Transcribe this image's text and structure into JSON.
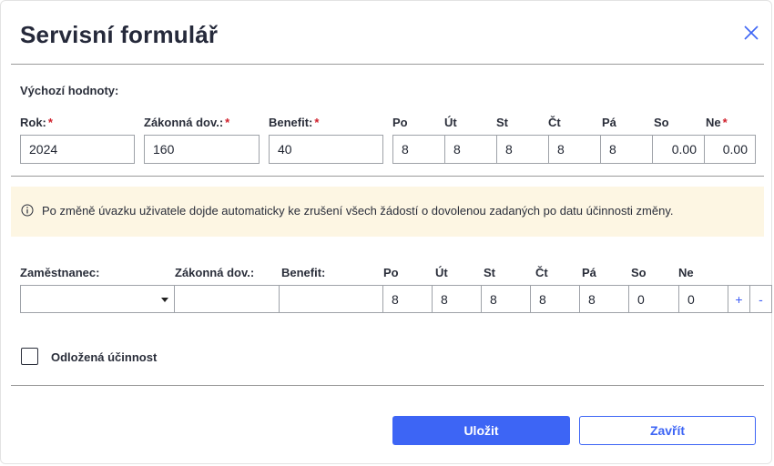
{
  "dialog": {
    "title": "Servisní formulář",
    "close_icon": "close-icon"
  },
  "defaults": {
    "section_label": "Výchozí hodnoty:",
    "year_label": "Rok:",
    "legal_label": "Zákonná dov.:",
    "benefit_label": "Benefit:",
    "required_mark": "*",
    "year_value": "2024",
    "legal_value": "160",
    "benefit_value": "40",
    "days": [
      {
        "label": "Po",
        "value": "8",
        "required": false
      },
      {
        "label": "Út",
        "value": "8",
        "required": false
      },
      {
        "label": "St",
        "value": "8",
        "required": false
      },
      {
        "label": "Čt",
        "value": "8",
        "required": false
      },
      {
        "label": "Pá",
        "value": "8",
        "required": false
      },
      {
        "label": "So",
        "value": "0.00",
        "required": false
      },
      {
        "label": "Ne",
        "value": "0.00",
        "required": true
      }
    ]
  },
  "info": {
    "icon": "info-icon",
    "text": "Po změně úvazku uživatele dojde automaticky ke zrušení všech žádostí o dovolenou zadaných po datu účinnosti změny."
  },
  "employee": {
    "employee_label": "Zaměstnanec:",
    "legal_label": "Zákonná dov.:",
    "benefit_label": "Benefit:",
    "employee_value": "",
    "legal_value": "",
    "benefit_value": "",
    "days": [
      {
        "label": "Po",
        "value": "8"
      },
      {
        "label": "Út",
        "value": "8"
      },
      {
        "label": "St",
        "value": "8"
      },
      {
        "label": "Čt",
        "value": "8"
      },
      {
        "label": "Pá",
        "value": "8"
      },
      {
        "label": "So",
        "value": "0"
      },
      {
        "label": "Ne",
        "value": "0"
      }
    ],
    "add_label": "+",
    "remove_label": "-"
  },
  "deferred": {
    "label": "Odložená účinnost",
    "checked": false
  },
  "actions": {
    "save_label": "Uložit",
    "close_label": "Zavřít"
  },
  "colors": {
    "accent": "#3d65f5",
    "required": "#d0202c",
    "info_bg": "#fdf6e3"
  }
}
